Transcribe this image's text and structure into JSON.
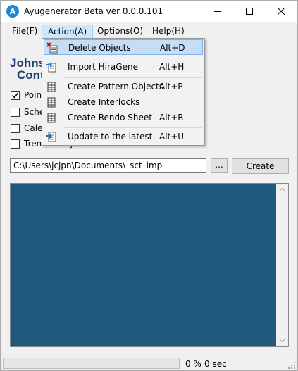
{
  "window": {
    "title": "Ayugenerator Beta ver 0.0.0.101",
    "app_icon_letter": "A"
  },
  "menu": {
    "items": [
      {
        "label": "File(F)"
      },
      {
        "label": "Action(A)"
      },
      {
        "label": "Options(O)"
      },
      {
        "label": "Help(H)"
      }
    ]
  },
  "logo": {
    "line1": "Johnso",
    "line2": "Cont"
  },
  "checkboxes": [
    {
      "label": "Point",
      "checked": true
    },
    {
      "label": "Sche",
      "checked": false
    },
    {
      "label": "Caler",
      "checked": false
    },
    {
      "label": "Trend Study",
      "checked": false
    }
  ],
  "path": {
    "value": "C:\\Users\\jcjpn\\Documents\\_sct_imp"
  },
  "buttons": {
    "browse": "...",
    "create": "Create"
  },
  "status": {
    "progress_percent": 0,
    "percent_text": "0 %",
    "time_text": "0 sec"
  },
  "action_menu": {
    "items": [
      {
        "label": "Delete Objects",
        "shortcut": "Alt+D",
        "icon": "delete-objects-icon",
        "highlighted": true
      },
      {
        "label": "Import HiraGene",
        "shortcut": "Alt+H",
        "icon": "import-icon"
      },
      {
        "label": "Create Pattern Objects",
        "shortcut": "Alt+P",
        "icon": "grid-doc-icon"
      },
      {
        "label": "Create Interlocks",
        "shortcut": "",
        "icon": "grid-doc-icon"
      },
      {
        "label": "Create Rendo Sheet",
        "shortcut": "Alt+R",
        "icon": "grid-doc-icon"
      },
      {
        "label": "Update to the latest",
        "shortcut": "Alt+U",
        "icon": "update-icon"
      }
    ]
  },
  "colors": {
    "output_bg": "#1f5a7e",
    "menu_highlight": "#c5def5",
    "progress_fill": "#06b025"
  }
}
